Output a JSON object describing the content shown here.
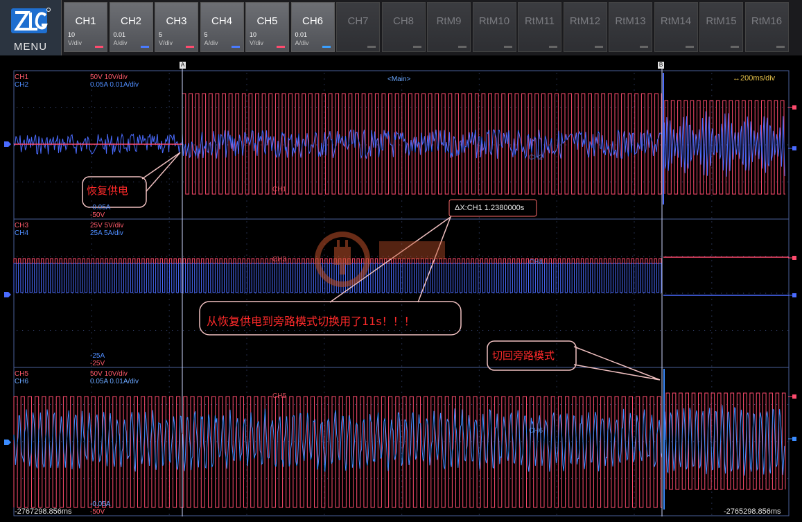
{
  "menu": {
    "label": "MENU"
  },
  "channels": [
    {
      "name": "CH1",
      "scale": "10",
      "unit": "V/div",
      "color": "#ff4b6e",
      "active": true
    },
    {
      "name": "CH2",
      "scale": "0.01",
      "unit": "A/div",
      "color": "#4a7bff",
      "active": true
    },
    {
      "name": "CH3",
      "scale": "5",
      "unit": "V/div",
      "color": "#ff4b6e",
      "active": true
    },
    {
      "name": "CH4",
      "scale": "5",
      "unit": "A/div",
      "color": "#4a7bff",
      "active": true
    },
    {
      "name": "CH5",
      "scale": "10",
      "unit": "V/div",
      "color": "#ff4b6e",
      "active": true
    },
    {
      "name": "CH6",
      "scale": "0.01",
      "unit": "A/div",
      "color": "#3aa0ff",
      "active": true
    },
    {
      "name": "CH7",
      "scale": "",
      "unit": "",
      "color": "#777",
      "active": false
    },
    {
      "name": "CH8",
      "scale": "",
      "unit": "",
      "color": "#777",
      "active": false
    },
    {
      "name": "RtM9",
      "scale": "",
      "unit": "",
      "color": "#777",
      "active": false
    },
    {
      "name": "RtM10",
      "scale": "",
      "unit": "",
      "color": "#777",
      "active": false
    },
    {
      "name": "RtM11",
      "scale": "",
      "unit": "",
      "color": "#777",
      "active": false
    },
    {
      "name": "RtM12",
      "scale": "",
      "unit": "",
      "color": "#777",
      "active": false
    },
    {
      "name": "RtM13",
      "scale": "",
      "unit": "",
      "color": "#777",
      "active": false
    },
    {
      "name": "RtM14",
      "scale": "",
      "unit": "",
      "color": "#777",
      "active": false
    },
    {
      "name": "RtM15",
      "scale": "",
      "unit": "",
      "color": "#777",
      "active": false
    },
    {
      "name": "RtM16",
      "scale": "",
      "unit": "",
      "color": "#777",
      "active": false
    }
  ],
  "display": {
    "main_label": "<Main>",
    "timebase": "↔200ms/div",
    "cursor_a": "A",
    "cursor_b": "B",
    "time_left": "-2767298.856ms",
    "time_right": "-2765298.856ms"
  },
  "panels": [
    {
      "ch_a": "CH1",
      "ch_b": "CH2",
      "info_a": "50V   10V/div",
      "info_b": "0.05A   0.01A/div",
      "bottom_a": "-0.05A",
      "bottom_b": "-50V",
      "trace_a": "CH1",
      "trace_b": "CH2"
    },
    {
      "ch_a": "CH3",
      "ch_b": "CH4",
      "info_a": "25V   5V/div",
      "info_b": "25A   5A/div",
      "bottom_a": "-25A",
      "bottom_b": "-25V",
      "trace_a": "CH3",
      "trace_b": "CH4"
    },
    {
      "ch_a": "CH5",
      "ch_b": "CH6",
      "info_a": "50V   10V/div",
      "info_b": "0.05A   0.01A/div",
      "bottom_a": "-0.05A",
      "bottom_b": "-50V",
      "trace_a": "CH5",
      "trace_b": "CH6"
    }
  ],
  "measurement": {
    "delta": "ΔX:CH1 1.2380000s"
  },
  "annotations": {
    "restore": "恢复供电",
    "duration": "从恢复供电到旁路模式切换用了11s！！！",
    "bypass": "切回旁路模式"
  },
  "colors": {
    "red_trace": "#ff4b6e",
    "blue_trace": "#4a6bff",
    "cyan_trace": "#3b8cff",
    "grid": "#3a4a7a",
    "callout_text": "#ff2a2a"
  }
}
